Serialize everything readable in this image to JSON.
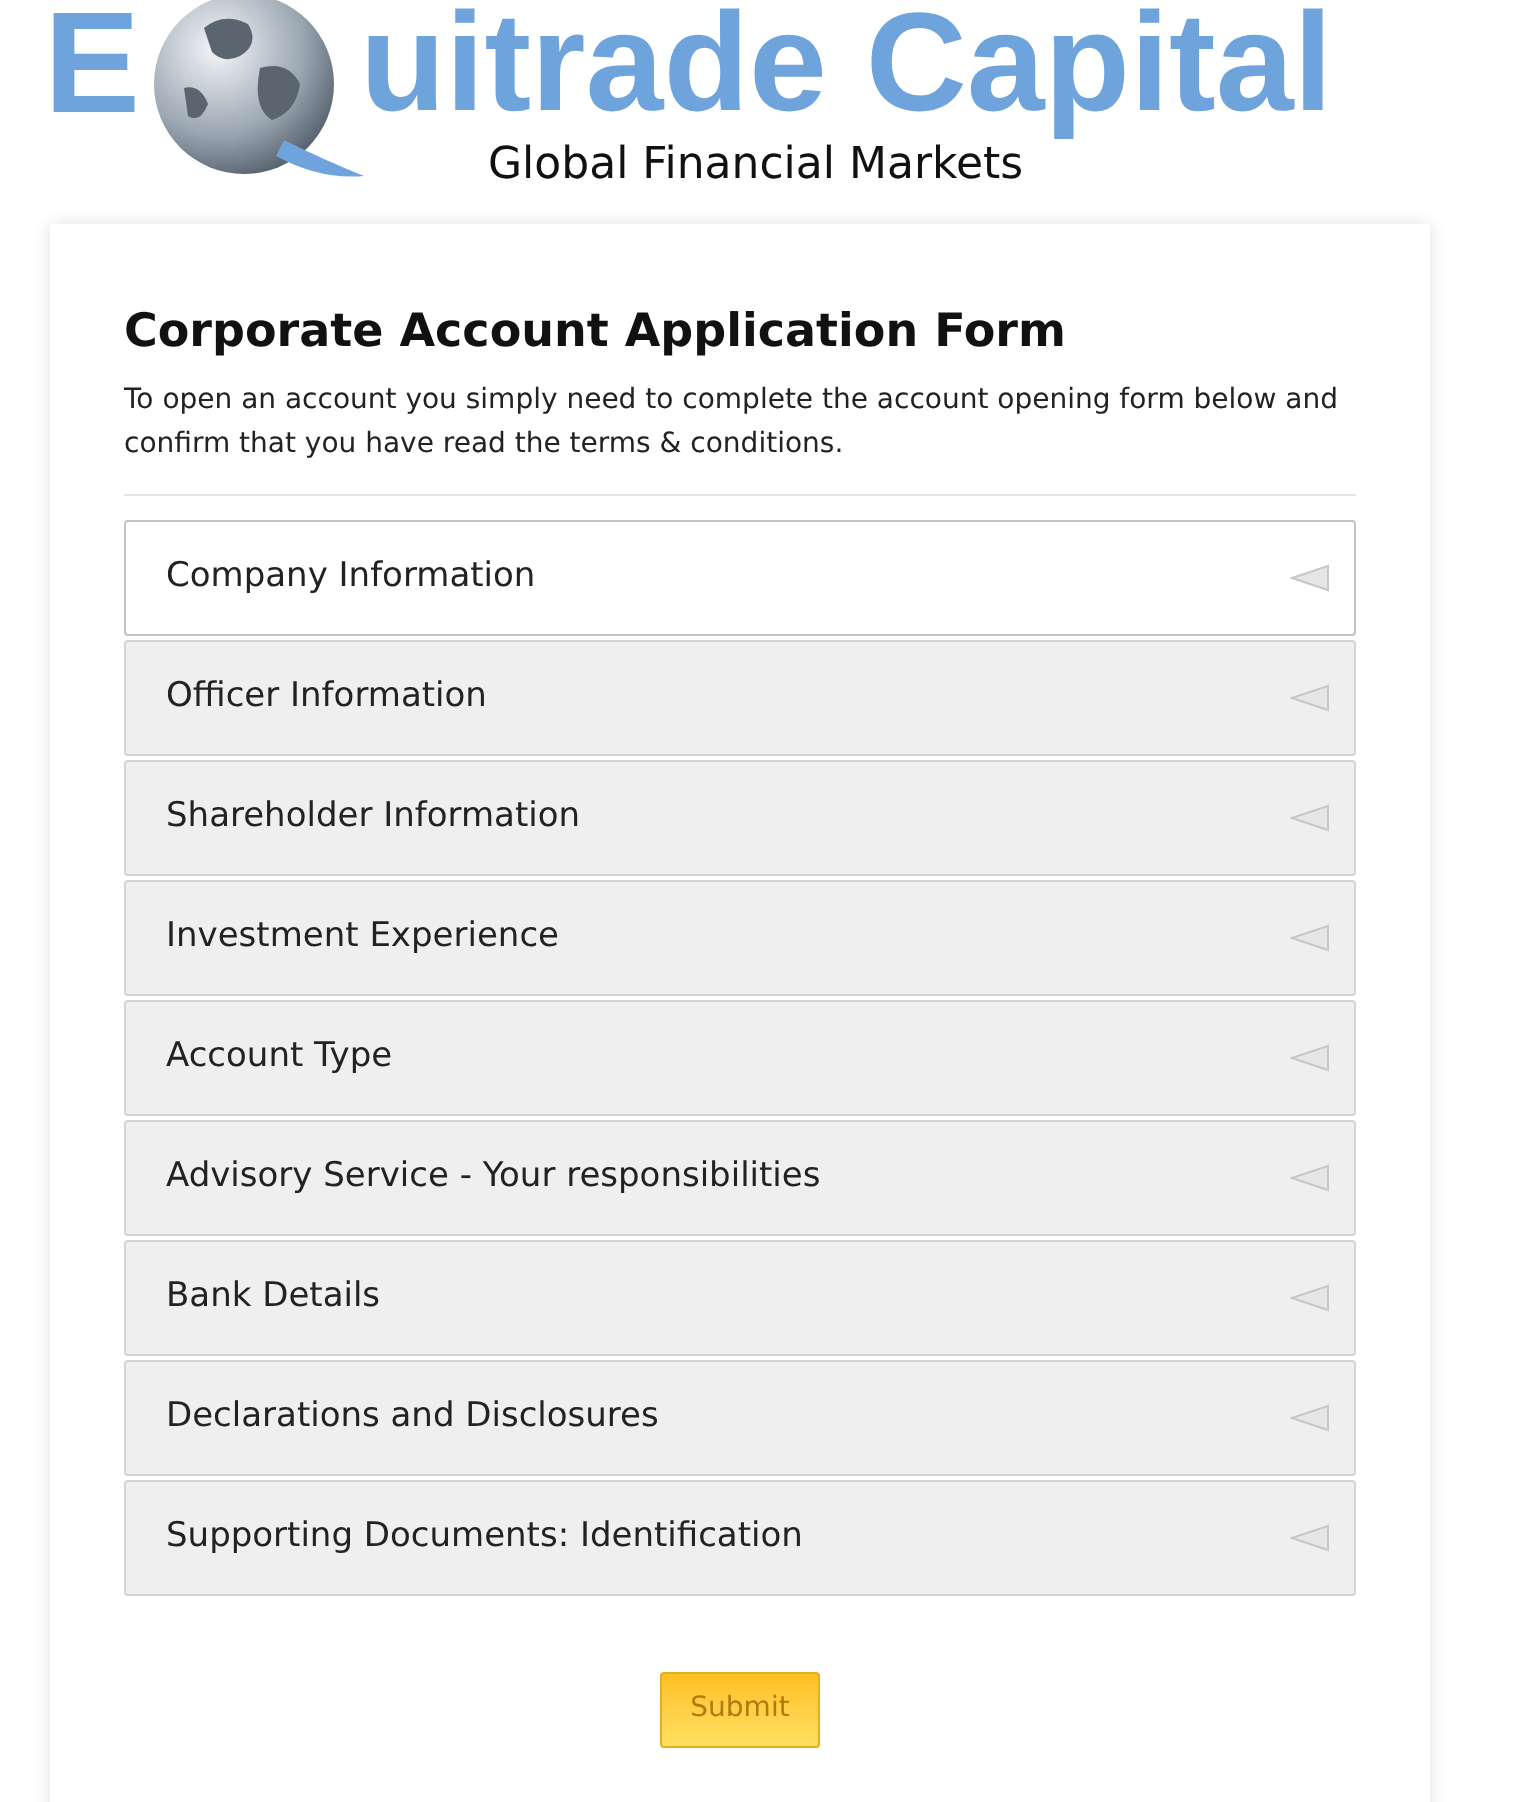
{
  "logo": {
    "letter": "E",
    "word": "uitrade Capital",
    "tagline": "Global Financial Markets"
  },
  "form": {
    "title": "Corporate Account Application Form",
    "intro": "To open an account you simply need to complete the account opening form below and confirm that you have read the terms & conditions.",
    "sections": [
      {
        "label": "Company Information",
        "selected": true
      },
      {
        "label": "Officer Information",
        "selected": false
      },
      {
        "label": "Shareholder Information",
        "selected": false
      },
      {
        "label": "Investment Experience",
        "selected": false
      },
      {
        "label": "Account Type",
        "selected": false
      },
      {
        "label": "Advisory Service - Your responsibilities",
        "selected": false
      },
      {
        "label": "Bank Details",
        "selected": false
      },
      {
        "label": "Declarations and Disclosures",
        "selected": false
      },
      {
        "label": "Supporting Documents: Identification",
        "selected": false
      }
    ],
    "submit": "Submit"
  }
}
